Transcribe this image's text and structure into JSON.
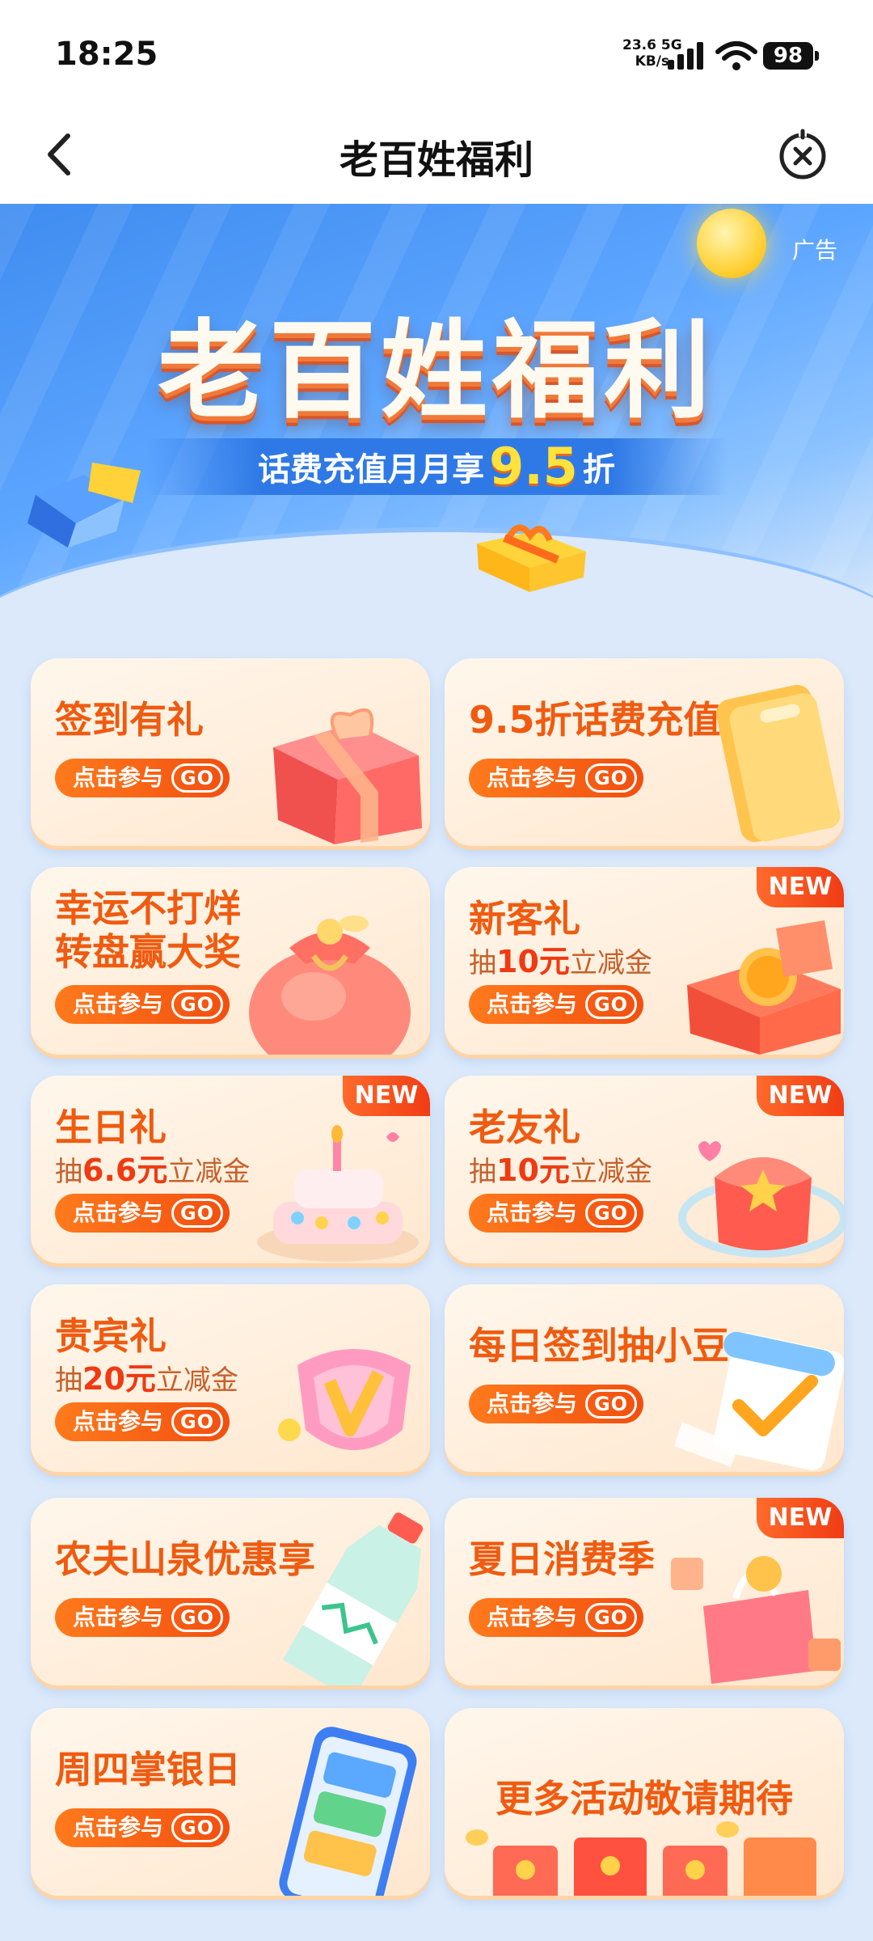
{
  "status_bar": {
    "time": "18:25",
    "net_speed": "23.6",
    "net_unit": "KB/s",
    "net_type": "5G",
    "battery": "98"
  },
  "nav": {
    "title": "老百姓福利",
    "back_icon": "chevron-left-icon",
    "close_icon": "close-circle-icon"
  },
  "banner": {
    "ad_label": "广告",
    "title": "老百姓福利",
    "subtitle_pre": "话费充值月月享",
    "subtitle_value": "9.5",
    "subtitle_post": "折"
  },
  "cta": {
    "label": "点击参与",
    "go": "GO"
  },
  "cards": [
    {
      "title": "签到有礼",
      "illustration": "gift-box"
    },
    {
      "title": "9.5折话费充值",
      "illustration": "phone-bill-coupon"
    },
    {
      "title_line1": "幸运不打烊",
      "title_line2": "转盘赢大奖",
      "illustration": "lucky-bag"
    },
    {
      "title": "新客礼",
      "sub_pre": "抽",
      "sub_amount": "10元",
      "sub_post": "立减金",
      "badge": "NEW",
      "illustration": "red-packet-box"
    },
    {
      "title": "生日礼",
      "sub_pre": "抽",
      "sub_amount": "6.6元",
      "sub_post": "立减金",
      "badge": "NEW",
      "illustration": "birthday-cake"
    },
    {
      "title": "老友礼",
      "sub_pre": "抽",
      "sub_amount": "10元",
      "sub_post": "立减金",
      "badge": "NEW",
      "illustration": "red-pouch"
    },
    {
      "title": "贵宾礼",
      "sub_pre": "抽",
      "sub_amount": "20元",
      "sub_post": "立减金",
      "illustration": "vip-badge"
    },
    {
      "title": "每日签到抽小豆",
      "illustration": "calendar-check"
    },
    {
      "title": "农夫山泉优惠享",
      "illustration": "water-bottle"
    },
    {
      "title": "夏日消费季",
      "badge": "NEW",
      "illustration": "shopping-bag"
    },
    {
      "title": "周四掌银日",
      "illustration": "mobile-phone"
    },
    {
      "title": "更多活动敬请期待",
      "illustration": "red-envelopes"
    }
  ],
  "colors": {
    "accent": "#ef5b10",
    "button": "#f24f0f",
    "card_bg": "#fff1e0",
    "page_bg": "#dbe9fb",
    "banner_blue": "#3f8cf0"
  }
}
